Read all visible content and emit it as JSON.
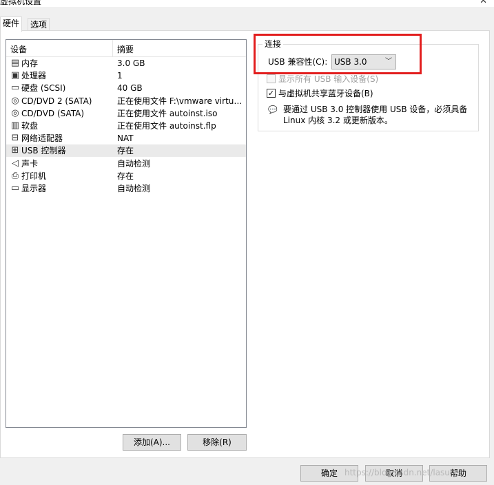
{
  "window": {
    "title": "虚拟机设置",
    "close_glyph": "✕"
  },
  "tabs": [
    {
      "label": "硬件"
    },
    {
      "label": "选项"
    }
  ],
  "device_list": {
    "headers": {
      "device": "设备",
      "summary": "摘要"
    },
    "rows": [
      {
        "name": "内存",
        "summary": "3.0 GB",
        "icon": "memory-icon",
        "glyph": "▤"
      },
      {
        "name": "处理器",
        "summary": "1",
        "icon": "processor-icon",
        "glyph": "▣"
      },
      {
        "name": "硬盘 (SCSI)",
        "summary": "40 GB",
        "icon": "hard-disk-icon",
        "glyph": "▭"
      },
      {
        "name": "CD/DVD 2 (SATA)",
        "summary": "正在使用文件 F:\\vmware virtua...",
        "icon": "cd-dvd-icon",
        "glyph": "◎"
      },
      {
        "name": "CD/DVD (SATA)",
        "summary": "正在使用文件 autoinst.iso",
        "icon": "cd-dvd-icon",
        "glyph": "◎"
      },
      {
        "name": "软盘",
        "summary": "正在使用文件 autoinst.flp",
        "icon": "floppy-icon",
        "glyph": "▥"
      },
      {
        "name": "网络适配器",
        "summary": "NAT",
        "icon": "network-adapter-icon",
        "glyph": "⊟"
      },
      {
        "name": "USB 控制器",
        "summary": "存在",
        "icon": "usb-icon",
        "glyph": "⊞",
        "selected": true
      },
      {
        "name": "声卡",
        "summary": "自动检测",
        "icon": "speaker-icon",
        "glyph": "◁"
      },
      {
        "name": "打印机",
        "summary": "存在",
        "icon": "printer-icon",
        "glyph": "⎙"
      },
      {
        "name": "显示器",
        "summary": "自动检测",
        "icon": "monitor-icon",
        "glyph": "▭"
      }
    ]
  },
  "list_buttons": {
    "add": "添加(A)...",
    "remove": "移除(R)"
  },
  "connection": {
    "legend": "连接",
    "compat_label": "USB 兼容性(C):",
    "compat_value": "USB 3.0",
    "chevron": "﹀",
    "show_all_usb": {
      "label": "显示所有 USB 输入设备(S)",
      "checked": false,
      "disabled": true
    },
    "share_bluetooth": {
      "label": "与虚拟机共享蓝牙设备(B)",
      "checked": true,
      "check_glyph": "✓"
    },
    "info_glyph": "💬",
    "info_text": "要通过 USB 3.0 控制器使用 USB 设备，必须具备 Linux 内核 3.2 或更新版本。"
  },
  "footer_buttons": {
    "ok": "确定",
    "cancel": "取消",
    "help": "帮助"
  },
  "watermark": "https://blog.csdn.net/lasuser",
  "colors": {
    "highlight": "#e21e1e",
    "selected_row": "#eaeaea"
  }
}
